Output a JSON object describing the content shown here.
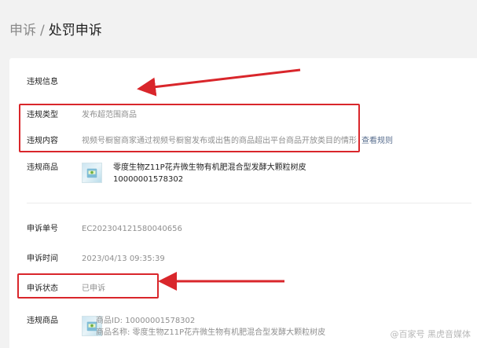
{
  "breadcrumb": {
    "parent": "申诉",
    "separator": "/",
    "current": "处罚申诉"
  },
  "violation_section": {
    "heading": "违规信息",
    "type_label": "违规类型",
    "type_value": "发布超范围商品",
    "content_label": "违规内容",
    "content_value": "视频号橱窗商家通过视频号橱窗发布或出售的商品超出平台商品开放类目的情形",
    "content_link": "查看规则",
    "product_label": "违规商品",
    "product_title": "零度生物Z11P花卉微生物有机肥混合型发酵大颗粒树皮",
    "product_id": "10000001578302"
  },
  "appeal_section": {
    "number_label": "申诉单号",
    "number_value": "EC2023041215800406​56",
    "time_label": "申诉时间",
    "time_value": "2023/04/13 09:35:39",
    "status_label": "申诉状态",
    "status_value": "已申诉",
    "product_label": "违规商品",
    "product_id_line": "商品ID: 10000001578302",
    "product_name_line": "商品名称: 零度生物Z11P花卉微生物有机肥混合型发酵大颗粒树皮"
  },
  "watermark": "@百家号 黑虎音媒体",
  "colors": {
    "highlight_red": "#d9262b",
    "link": "#5a6f8f"
  }
}
